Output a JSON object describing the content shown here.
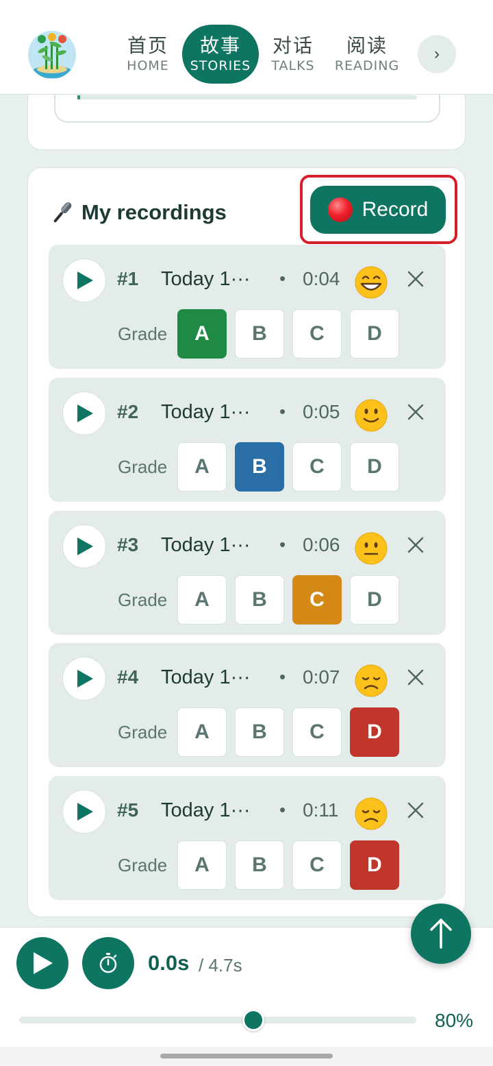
{
  "nav": {
    "tabs": [
      {
        "zh": "首页",
        "en": "HOME",
        "active": false
      },
      {
        "zh": "故事",
        "en": "STORIES",
        "active": true
      },
      {
        "zh": "对话",
        "en": "TALKS",
        "active": false
      },
      {
        "zh": "阅读",
        "en": "READING",
        "active": false
      }
    ],
    "more_icon": "chevron-right-icon",
    "more_glyph": "›"
  },
  "recordings": {
    "title": "My recordings",
    "title_icon": "microphone-icon",
    "record_label": "Record",
    "grade_label": "Grade",
    "grade_options": [
      "A",
      "B",
      "C",
      "D"
    ],
    "items": [
      {
        "num": "#1",
        "date": "Today 1···",
        "sep": "•",
        "duration": "0:04",
        "emoji": "grinning-face-icon",
        "grade": "A"
      },
      {
        "num": "#2",
        "date": "Today 1···",
        "sep": "•",
        "duration": "0:05",
        "emoji": "slightly-smiling-face-icon",
        "grade": "B"
      },
      {
        "num": "#3",
        "date": "Today 1···",
        "sep": "•",
        "duration": "0:06",
        "emoji": "neutral-face-icon",
        "grade": "C"
      },
      {
        "num": "#4",
        "date": "Today 1···",
        "sep": "•",
        "duration": "0:07",
        "emoji": "disappointed-face-icon",
        "grade": "D"
      },
      {
        "num": "#5",
        "date": "Today 1···",
        "sep": "•",
        "duration": "0:11",
        "emoji": "disappointed-face-icon",
        "grade": "D"
      }
    ]
  },
  "player": {
    "current_time": "0.0s",
    "total_time": "/ 4.7s",
    "speed_label": "80%",
    "speed_fraction": 0.59
  },
  "colors": {
    "brand": "#0f7563",
    "grade_A": "#1f8a45",
    "grade_B": "#2a6ea8",
    "grade_C": "#d48916",
    "grade_D": "#c0362a",
    "highlight": "#d3202a"
  }
}
